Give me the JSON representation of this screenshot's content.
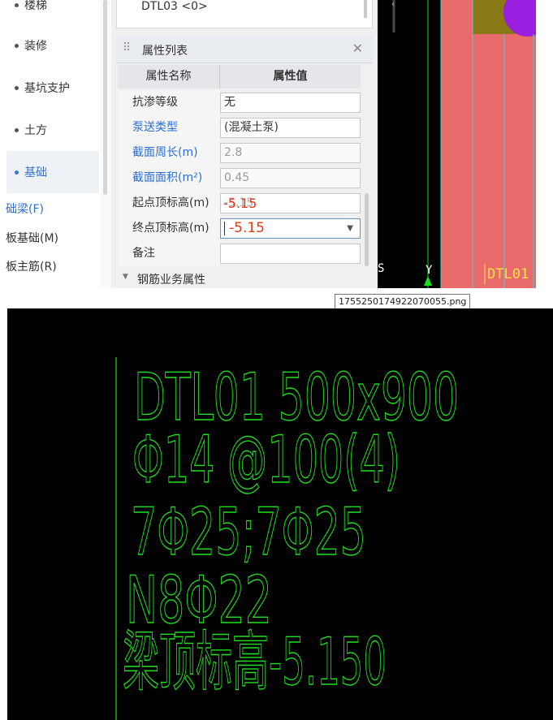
{
  "sidebar": {
    "items": [
      {
        "label": "楼梯",
        "active": false
      },
      {
        "label": "装修",
        "active": false
      },
      {
        "label": "基坑支护",
        "active": false
      },
      {
        "label": "土方",
        "active": false
      },
      {
        "label": "基础",
        "active": true
      }
    ],
    "subitems": [
      {
        "label": "础梁(F)"
      },
      {
        "label": "板基础(M)"
      },
      {
        "label": "板主筋(R)"
      }
    ]
  },
  "component_list": {
    "current_item": "DTL03 <0>"
  },
  "property_panel": {
    "title": "属性列表",
    "close_icon": "close-icon",
    "column_name": "属性名称",
    "column_value": "属性值",
    "rows": [
      {
        "name": "抗渗等级",
        "value": "无",
        "linked": false
      },
      {
        "name": "泵送类型",
        "value": "(混凝土泵)",
        "linked": true
      },
      {
        "name": "截面周长(m)",
        "value": "2.8",
        "linked": true
      },
      {
        "name": "截面面积(m²)",
        "value": "0.45",
        "linked": true
      },
      {
        "name": "起点顶标高(m)",
        "value": "-5.15",
        "overlay": "-5.15",
        "linked": false
      },
      {
        "name": "终点顶标高(m)",
        "value": "-5.15",
        "linked": false,
        "editing": true
      },
      {
        "name": "备注",
        "value": "",
        "linked": false
      }
    ],
    "section": "钢筋业务属性"
  },
  "cad_top": {
    "label": "DTL01",
    "axis_label": "Y",
    "colors": {
      "background": "#000000",
      "beam": "#e96a6a",
      "line": "#17e017",
      "cyan": "#3fd6d6",
      "olive": "#8a7a17",
      "violet": "#9b1fe0"
    }
  },
  "tooltip": {
    "text": "1755250174922070055.png"
  },
  "cad_bottom": {
    "color": "#1fe01f",
    "lines": [
      "DTL01 500x900",
      "Φ14 @100(4)",
      "7Φ25;7Φ25",
      "N8Φ22",
      "梁顶标高-5.150"
    ]
  }
}
